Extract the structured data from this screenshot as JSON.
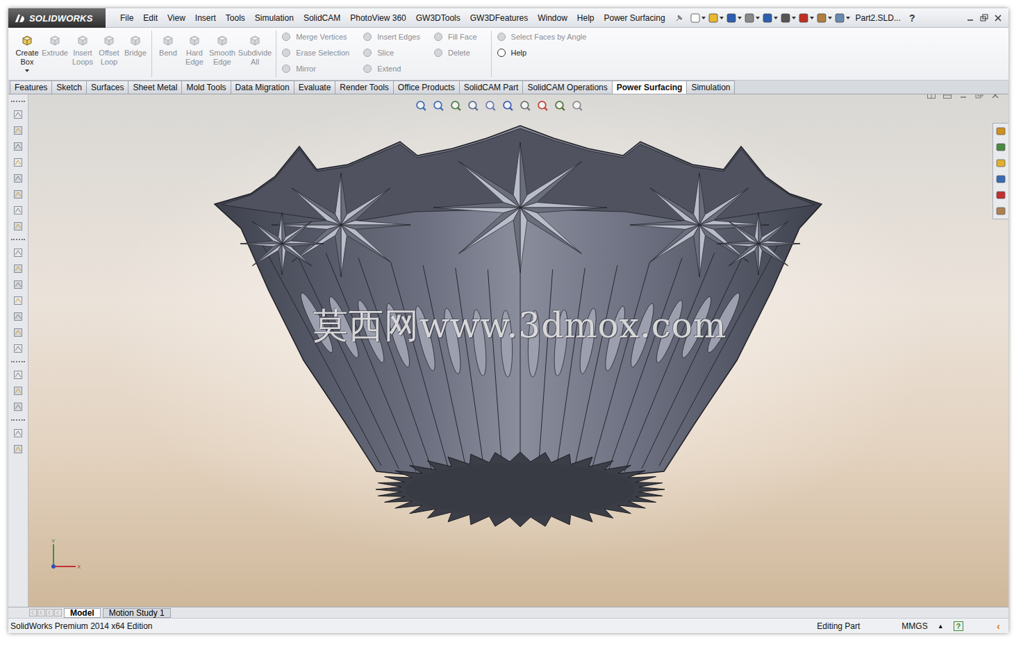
{
  "app": {
    "logo": "SOLIDWORKS",
    "document": "Part2.SLD...",
    "help": "?"
  },
  "menu": [
    "File",
    "Edit",
    "View",
    "Insert",
    "Tools",
    "Simulation",
    "SolidCAM",
    "PhotoView 360",
    "GW3DTools",
    "GW3DFeatures",
    "Window",
    "Help",
    "Power Surfacing"
  ],
  "ribbon_groups": [
    {
      "kind": "large",
      "buttons": [
        {
          "label": "Create Box",
          "disabled": false
        },
        {
          "label": "Extrude",
          "disabled": true
        },
        {
          "label": "Insert Loops",
          "disabled": true
        },
        {
          "label": "Offset Loop",
          "disabled": true
        },
        {
          "label": "Bridge",
          "disabled": true
        }
      ]
    },
    {
      "kind": "large",
      "buttons": [
        {
          "label": "Bend",
          "disabled": true
        },
        {
          "label": "Hard Edge",
          "disabled": true
        },
        {
          "label": "Smooth Edge",
          "disabled": true
        },
        {
          "label": "Subdivide All",
          "disabled": true
        }
      ]
    },
    {
      "kind": "small",
      "columns": [
        [
          {
            "label": "Merge Vertices",
            "disabled": true
          },
          {
            "label": "Erase Selection",
            "disabled": true
          },
          {
            "label": "Mirror",
            "disabled": true
          }
        ],
        [
          {
            "label": "Insert Edges",
            "disabled": true
          },
          {
            "label": "Slice",
            "disabled": true
          },
          {
            "label": "Extend",
            "disabled": true
          }
        ],
        [
          {
            "label": "Fill Face",
            "disabled": true
          },
          {
            "label": "Delete",
            "disabled": true
          }
        ]
      ]
    },
    {
      "kind": "small",
      "columns": [
        [
          {
            "label": "Select Faces by Angle",
            "disabled": true
          },
          {
            "label": "Help",
            "disabled": false
          }
        ]
      ]
    }
  ],
  "tabs": [
    {
      "label": "Features",
      "selected": false
    },
    {
      "label": "Sketch",
      "selected": false
    },
    {
      "label": "Surfaces",
      "selected": false
    },
    {
      "label": "Sheet Metal",
      "selected": false
    },
    {
      "label": "Mold Tools",
      "selected": false
    },
    {
      "label": "Data Migration",
      "selected": false
    },
    {
      "label": "Evaluate",
      "selected": false
    },
    {
      "label": "Render Tools",
      "selected": false
    },
    {
      "label": "Office Products",
      "selected": false
    },
    {
      "label": "SolidCAM Part",
      "selected": false
    },
    {
      "label": "SolidCAM Operations",
      "selected": false
    },
    {
      "label": "Power Surfacing",
      "selected": true
    },
    {
      "label": "Simulation",
      "selected": false
    }
  ],
  "watermark": "莫西网www.3dmox.com",
  "triad": {
    "y": "Y",
    "x": "X"
  },
  "bottom_tabs": [
    {
      "label": "Model",
      "selected": true
    },
    {
      "label": "Motion Study 1",
      "selected": false
    }
  ],
  "status_bar": {
    "product": "SolidWorks Premium 2014 x64 Edition",
    "mode": "Editing Part",
    "units": "MMGS",
    "units_arrow": "▲",
    "help": "?",
    "collapse": "‹"
  }
}
